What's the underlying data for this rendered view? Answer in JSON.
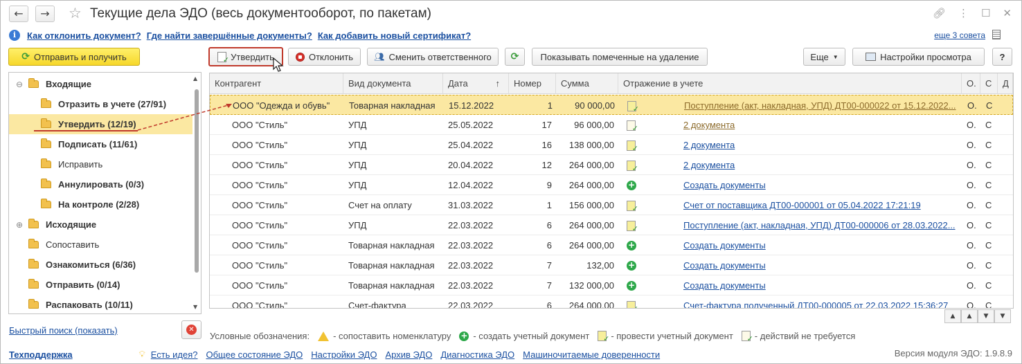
{
  "title": "Текущие дела ЭДО (весь документооборот, по пакетам)",
  "tips": {
    "links": [
      "Как отклонить документ?",
      "Где найти завершённые документы?",
      "Как добавить новый сертификат?"
    ],
    "more": "еще 3 совета"
  },
  "toolbar": {
    "send_receive": "Отправить и получить",
    "approve": "Утвердить",
    "reject": "Отклонить",
    "change_responsible": "Сменить ответственного",
    "show_deleted": "Показывать помеченные на удаление",
    "more": "Еще",
    "view_settings": "Настройки просмотра",
    "help": "?"
  },
  "tree": [
    {
      "label": "Входящие",
      "bold": true,
      "level": 0,
      "expander": "⊖"
    },
    {
      "label": "Отразить в учете (27/91)",
      "bold": true,
      "level": 1
    },
    {
      "label": "Утвердить (12/19)",
      "bold": true,
      "level": 1,
      "selected": true
    },
    {
      "label": "Подписать (11/61)",
      "bold": true,
      "level": 1
    },
    {
      "label": "Исправить",
      "bold": false,
      "level": 1
    },
    {
      "label": "Аннулировать (0/3)",
      "bold": true,
      "level": 1
    },
    {
      "label": "На контроле (2/28)",
      "bold": true,
      "level": 1
    },
    {
      "label": "Исходящие",
      "bold": true,
      "level": 0,
      "expander": "⊕"
    },
    {
      "label": "Сопоставить",
      "bold": false,
      "level": 0
    },
    {
      "label": "Ознакомиться (6/36)",
      "bold": true,
      "level": 0
    },
    {
      "label": "Отправить (0/14)",
      "bold": true,
      "level": 0
    },
    {
      "label": "Распаковать (10/11)",
      "bold": true,
      "level": 0
    }
  ],
  "table": {
    "columns": [
      "Контрагент",
      "Вид документа",
      "Дата",
      "Номер",
      "Сумма",
      "Отражение в учете",
      "О.",
      "С",
      "Д"
    ],
    "sort_indicator": "↑",
    "rows": [
      {
        "contractor": "ООО \"Одежда и обувь\"",
        "doc_type": "Товарная накладная",
        "date": "15.12.2022",
        "number": "1",
        "sum": "90 000,00",
        "icon": "list-yellow",
        "reflection": "Поступление (акт, накладная, УПД) ДТ00-000022 от 15.12.2022...",
        "link_color": "tan",
        "o": "О.",
        "s": "С",
        "selected": true
      },
      {
        "contractor": "ООО \"Стиль\"",
        "doc_type": "УПД",
        "date": "25.05.2022",
        "number": "17",
        "sum": "96 000,00",
        "icon": "list",
        "reflection": "2 документа",
        "link_color": "tan",
        "o": "О.",
        "s": "С"
      },
      {
        "contractor": "ООО \"Стиль\"",
        "doc_type": "УПД",
        "date": "25.04.2022",
        "number": "16",
        "sum": "138 000,00",
        "icon": "list-yellow",
        "reflection": "2 документа",
        "link_color": "blue",
        "o": "О.",
        "s": "С"
      },
      {
        "contractor": "ООО \"Стиль\"",
        "doc_type": "УПД",
        "date": "20.04.2022",
        "number": "12",
        "sum": "264 000,00",
        "icon": "list-yellow",
        "reflection": "2 документа",
        "link_color": "blue",
        "o": "О.",
        "s": "С"
      },
      {
        "contractor": "ООО \"Стиль\"",
        "doc_type": "УПД",
        "date": "12.04.2022",
        "number": "9",
        "sum": "264 000,00",
        "icon": "plus",
        "reflection": "Создать документы",
        "link_color": "blue",
        "o": "О.",
        "s": "С"
      },
      {
        "contractor": "ООО \"Стиль\"",
        "doc_type": "Счет на оплату",
        "date": "31.03.2022",
        "number": "1",
        "sum": "156 000,00",
        "icon": "list-yellow",
        "reflection": "Счет от поставщика ДТ00-000001 от 05.04.2022 17:21:19",
        "link_color": "blue",
        "o": "О.",
        "s": "С"
      },
      {
        "contractor": "ООО \"Стиль\"",
        "doc_type": "УПД",
        "date": "22.03.2022",
        "number": "6",
        "sum": "264 000,00",
        "icon": "list-yellow",
        "reflection": "Поступление (акт, накладная, УПД) ДТ00-000006 от 28.03.2022...",
        "link_color": "blue",
        "o": "О.",
        "s": "С"
      },
      {
        "contractor": "ООО \"Стиль\"",
        "doc_type": "Товарная накладная",
        "date": "22.03.2022",
        "number": "6",
        "sum": "264 000,00",
        "icon": "plus",
        "reflection": "Создать документы",
        "link_color": "blue",
        "o": "О.",
        "s": "С"
      },
      {
        "contractor": "ООО \"Стиль\"",
        "doc_type": "Товарная накладная",
        "date": "22.03.2022",
        "number": "7",
        "sum": "132,00",
        "icon": "plus",
        "reflection": "Создать документы",
        "link_color": "blue",
        "o": "О.",
        "s": "С"
      },
      {
        "contractor": "ООО \"Стиль\"",
        "doc_type": "Товарная накладная",
        "date": "22.03.2022",
        "number": "7",
        "sum": "132 000,00",
        "icon": "plus",
        "reflection": "Создать документы",
        "link_color": "blue",
        "o": "О.",
        "s": "С"
      },
      {
        "contractor": "ООО \"Стиль\"",
        "doc_type": "Счет-фактура",
        "date": "22.03.2022",
        "number": "6",
        "sum": "264 000,00",
        "icon": "list-yellow",
        "reflection": "Счет-фактура полученный ДТ00-000005 от 22.03.2022 15:36:27",
        "link_color": "blue",
        "o": "О.",
        "s": "С"
      }
    ]
  },
  "quick_search": "Быстрый поиск (показать)",
  "legend": {
    "title": "Условные обозначения:",
    "items": [
      {
        "icon": "warning-icon",
        "label": "- сопоставить номенклатуру"
      },
      {
        "icon": "plus-icon",
        "label": "- создать учетный документ"
      },
      {
        "icon": "post-icon",
        "label": "- провести учетный документ"
      },
      {
        "icon": "done-icon",
        "label": "- действий не требуется"
      }
    ]
  },
  "footer": {
    "support": "Техподдержка",
    "links": [
      "Есть идея?",
      "Общее состояние ЭДО",
      "Настройки ЭДО",
      "Архив ЭДО",
      "Диагностика ЭДО",
      "Машиночитаемые доверенности"
    ],
    "version": "Версия модуля ЭДО: 1.9.8.9"
  },
  "colors": {
    "selection": "#fbe8a2",
    "link": "#1a4fa0",
    "accent_button": "#f6d72a",
    "highlight_border": "#c0392b"
  }
}
